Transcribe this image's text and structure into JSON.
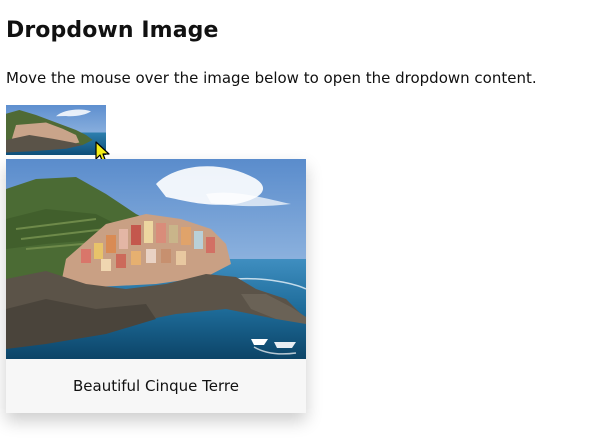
{
  "page": {
    "title": "Dropdown Image",
    "description": "Move the mouse over the image below to open the dropdown content."
  },
  "thumbnail": {
    "icon": "landscape-photo-thumbnail"
  },
  "dropdown": {
    "caption": "Beautiful Cinque Terre",
    "image_icon": "cinque-terre-photo"
  },
  "cursor": {
    "icon": "pointer-cursor-icon",
    "color": "#f5ee18"
  },
  "colors": {
    "sky": "#6f9fd8",
    "sea": "#1e6c9a",
    "cliff": "#5b5348",
    "green": "#4b6b34",
    "dropdown_bg": "#f7f7f7"
  }
}
